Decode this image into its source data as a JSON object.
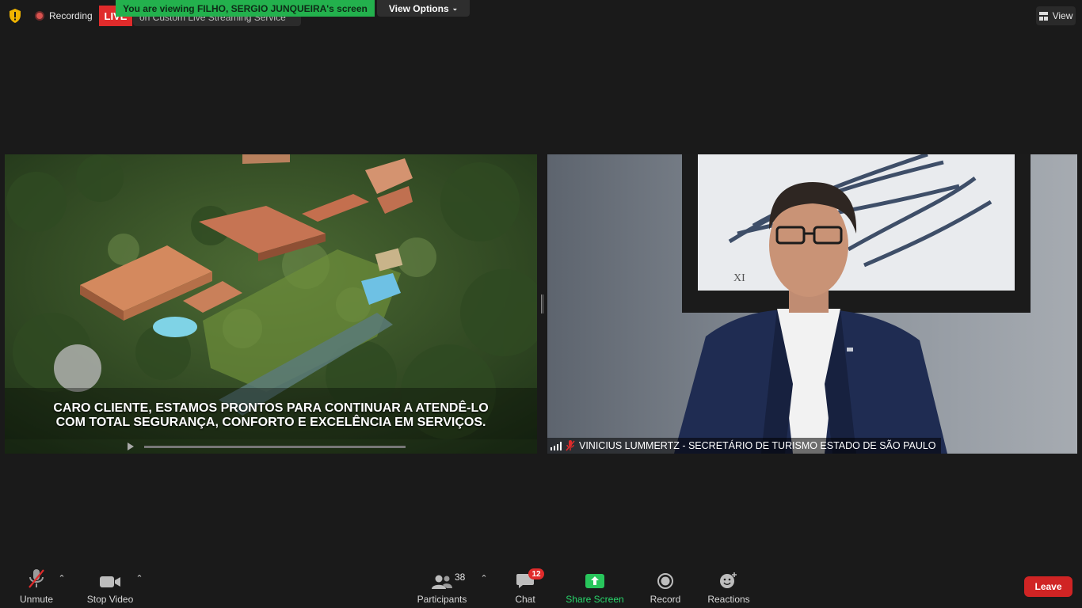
{
  "top_bar": {
    "recording_label": "Recording",
    "live_label": "LIVE",
    "live_service_text": "on Custom Live Streaming Service",
    "viewing_banner": "You are viewing FILHO, SERGIO JUNQUEIRA's screen",
    "view_options_label": "View Options",
    "view_label": "View"
  },
  "shared_screen": {
    "caption_line1": "CARO CLIENTE, ESTAMOS PRONTOS PARA CONTINUAR A ATENDÊ-LO",
    "caption_line2": "COM TOTAL SEGURANÇA, CONFORTO E EXCELÊNCIA EM SERVIÇOS."
  },
  "participant_video": {
    "name": "VINICIUS LUMMERTZ - SECRETÁRIO DE TURISMO ESTADO DE SÃO PAULO",
    "muted": true
  },
  "toolbar": {
    "unmute_label": "Unmute",
    "stop_video_label": "Stop Video",
    "participants_label": "Participants",
    "participants_count": "38",
    "chat_label": "Chat",
    "chat_badge": "12",
    "share_screen_label": "Share Screen",
    "record_label": "Record",
    "reactions_label": "Reactions",
    "leave_label": "Leave"
  },
  "colors": {
    "background": "#1a1a1a",
    "banner_green": "#23b14d",
    "live_red": "#e02b2b",
    "leave_red": "#d02424",
    "share_green": "#28d66b"
  }
}
